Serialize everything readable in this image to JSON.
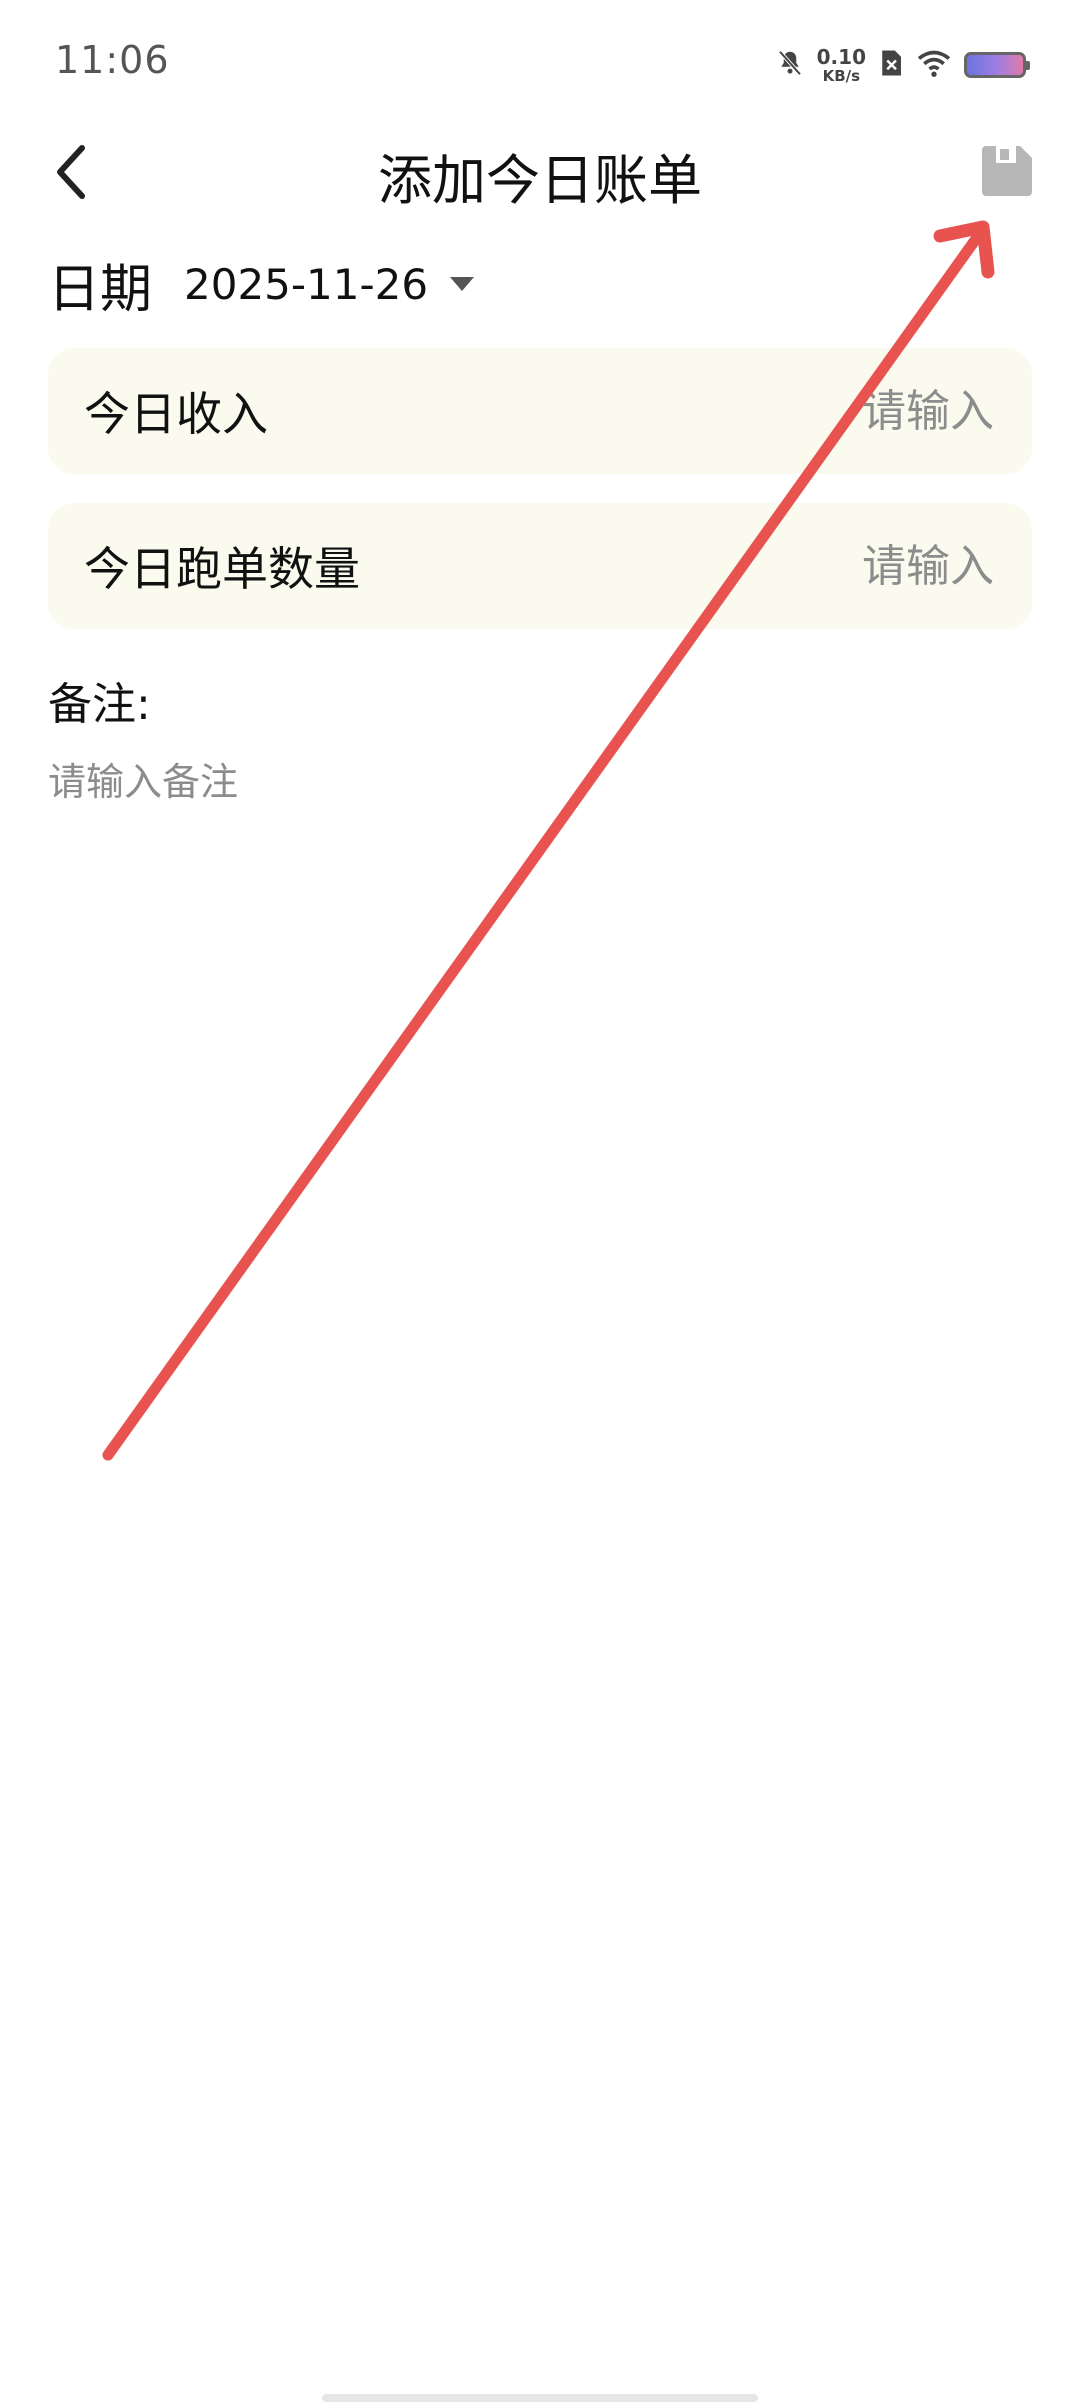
{
  "status_bar": {
    "time": "11:06",
    "net_speed_value": "0.10",
    "net_speed_unit": "KB/s",
    "icons": [
      "mute-bell-icon",
      "sim-off-icon",
      "wifi-icon",
      "battery-icon"
    ]
  },
  "header": {
    "title": "添加今日账单",
    "back_icon": "chevron-left-icon",
    "save_icon": "floppy-disk-icon"
  },
  "date": {
    "label": "日期",
    "value": "2025-11-26"
  },
  "fields": {
    "income": {
      "label": "今日收入",
      "placeholder": "请输入"
    },
    "orders": {
      "label": "今日跑单数量",
      "placeholder": "请输入"
    }
  },
  "remark": {
    "label": "备注:",
    "placeholder": "请输入备注"
  },
  "colors": {
    "card_background": "#fbfaee",
    "annotation_arrow": "#e8534f",
    "placeholder_text": "#8c8c8c"
  }
}
